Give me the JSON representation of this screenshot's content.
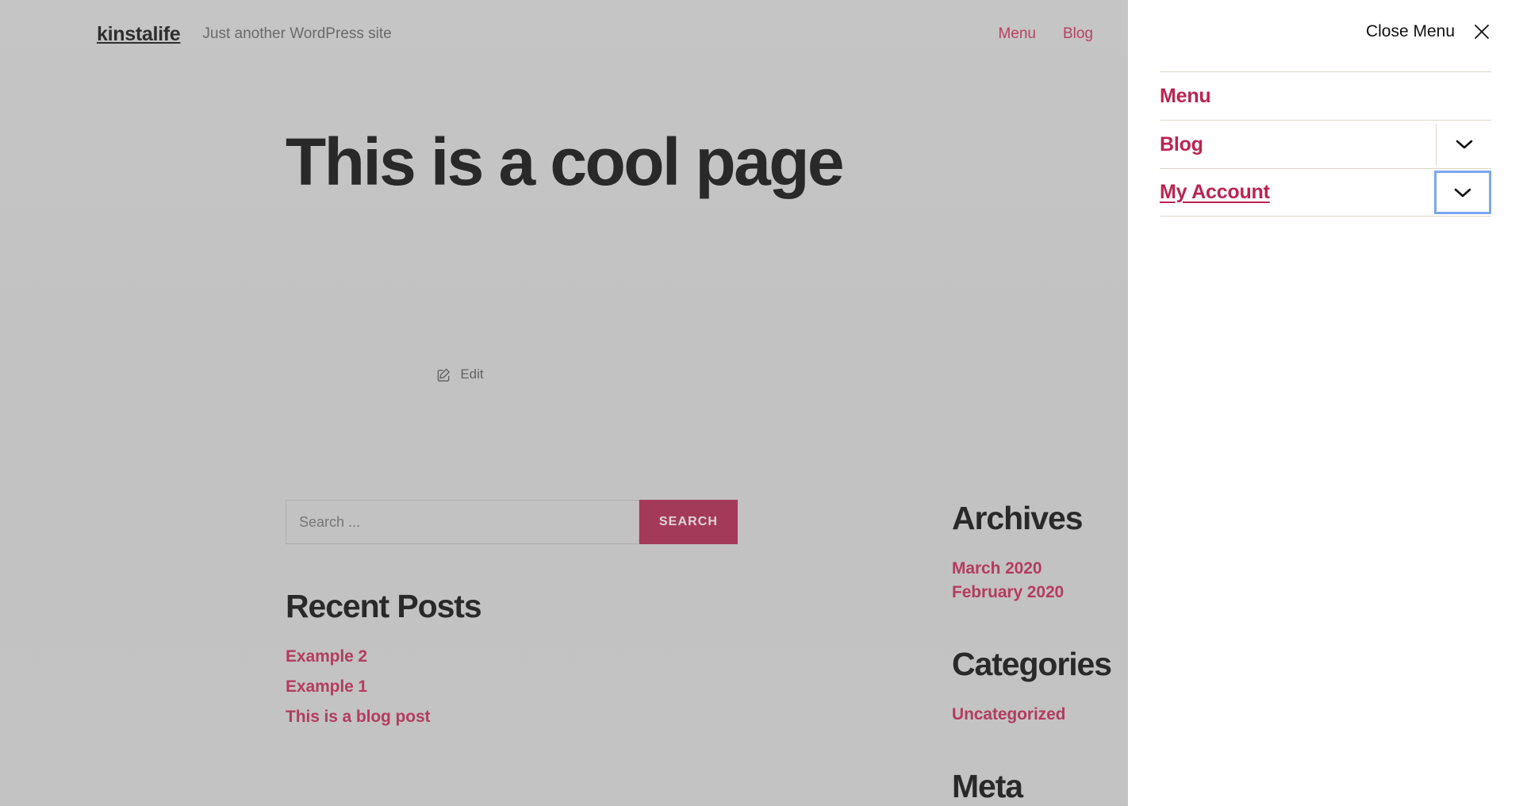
{
  "site": {
    "title": "kinstalife",
    "tagline": "Just another WordPress site",
    "nav": [
      {
        "label": "Menu"
      },
      {
        "label": "Blog"
      }
    ]
  },
  "hero": {
    "page_title": "This is a cool page",
    "edit_label": "Edit",
    "edit_icon": "pencil-square-icon"
  },
  "search": {
    "placeholder": "Search ...",
    "value": "",
    "button_label": "SEARCH"
  },
  "widgets": {
    "recent_posts": {
      "title": "Recent Posts",
      "items": [
        {
          "label": "Example 2"
        },
        {
          "label": "Example 1"
        },
        {
          "label": "This is a blog post"
        }
      ]
    },
    "archives": {
      "title": "Archives",
      "items": [
        {
          "label": "March 2020"
        },
        {
          "label": "February 2020"
        }
      ]
    },
    "categories": {
      "title": "Categories",
      "items": [
        {
          "label": "Uncategorized"
        }
      ]
    },
    "meta": {
      "title": "Meta"
    }
  },
  "menu_panel": {
    "close_label": "Close Menu",
    "close_icon": "close-x-icon",
    "items": [
      {
        "label": "Menu",
        "has_submenu": false,
        "submenu_icon": "",
        "state": ""
      },
      {
        "label": "Blog",
        "has_submenu": true,
        "submenu_icon": "chevron-down-icon",
        "state": ""
      },
      {
        "label": "My Account",
        "has_submenu": true,
        "submenu_icon": "chevron-down-icon",
        "state": "focused"
      }
    ]
  },
  "colors": {
    "link_crimson": "#bb2350",
    "button_crimson": "#a8204a",
    "focus_blue": "#7ba7f0",
    "divider": "#ddd5c9",
    "page_bg": "#d0d0d0",
    "panel_bg": "#ffffff"
  }
}
